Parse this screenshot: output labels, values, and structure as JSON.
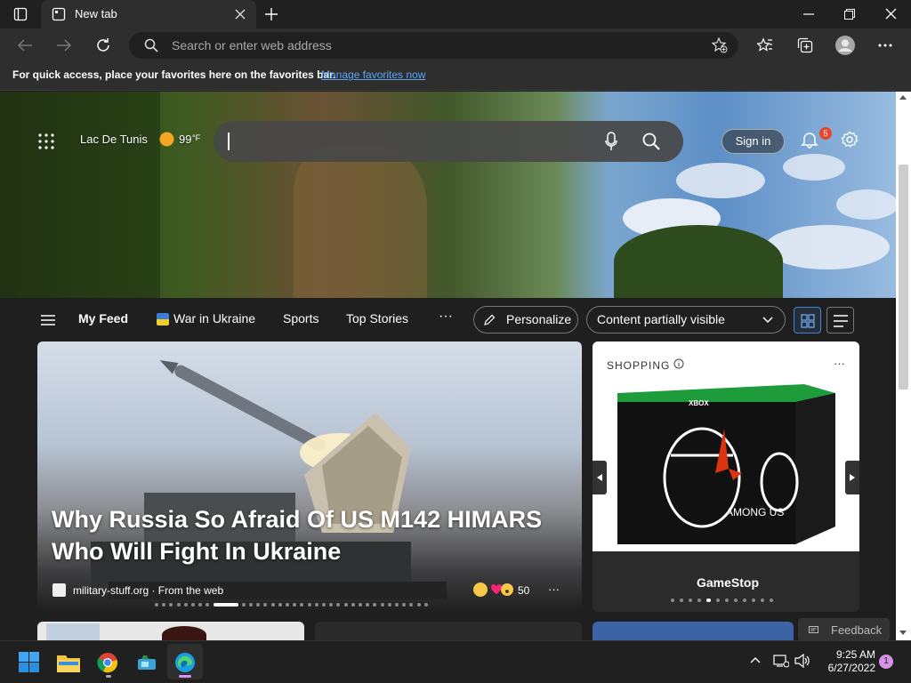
{
  "browser": {
    "tab_title": "New tab",
    "address_placeholder": "Search or enter web address"
  },
  "favorites_bar": {
    "message": "For quick access, place your favorites here on the favorites bar.",
    "link": "Manage favorites now"
  },
  "header": {
    "location": "Lac De Tunis",
    "temperature": "99",
    "temp_unit": "°F",
    "sign_in": "Sign in",
    "notification_count": "5"
  },
  "feed_nav": {
    "items": [
      "My Feed",
      "War in Ukraine",
      "Sports",
      "Top Stories"
    ],
    "more": "···",
    "personalize": "Personalize",
    "visibility": "Content partially visible"
  },
  "main_article": {
    "headline": "Why Russia So Afraid Of US M142 HIMARS Who Will Fight In Ukraine",
    "source": "military-stuff.org · From the web",
    "reaction_count": "50",
    "more": "···",
    "carousel_dot_count": 35,
    "carousel_active_index": 8
  },
  "shopping_card": {
    "label": "SHOPPING",
    "more": "···",
    "product_brand": "XBOX",
    "product_title": "AMONG US",
    "store": "GameStop",
    "carousel_dot_count": 12,
    "carousel_active_index": 4
  },
  "feedback": "Feedback",
  "taskbar": {
    "time": "9:25 AM",
    "date": "6/27/2022",
    "notification_count": "1"
  },
  "colors": {
    "accent": "#3f85d4",
    "link": "#5aa6f5",
    "badge": "#e8452f"
  }
}
